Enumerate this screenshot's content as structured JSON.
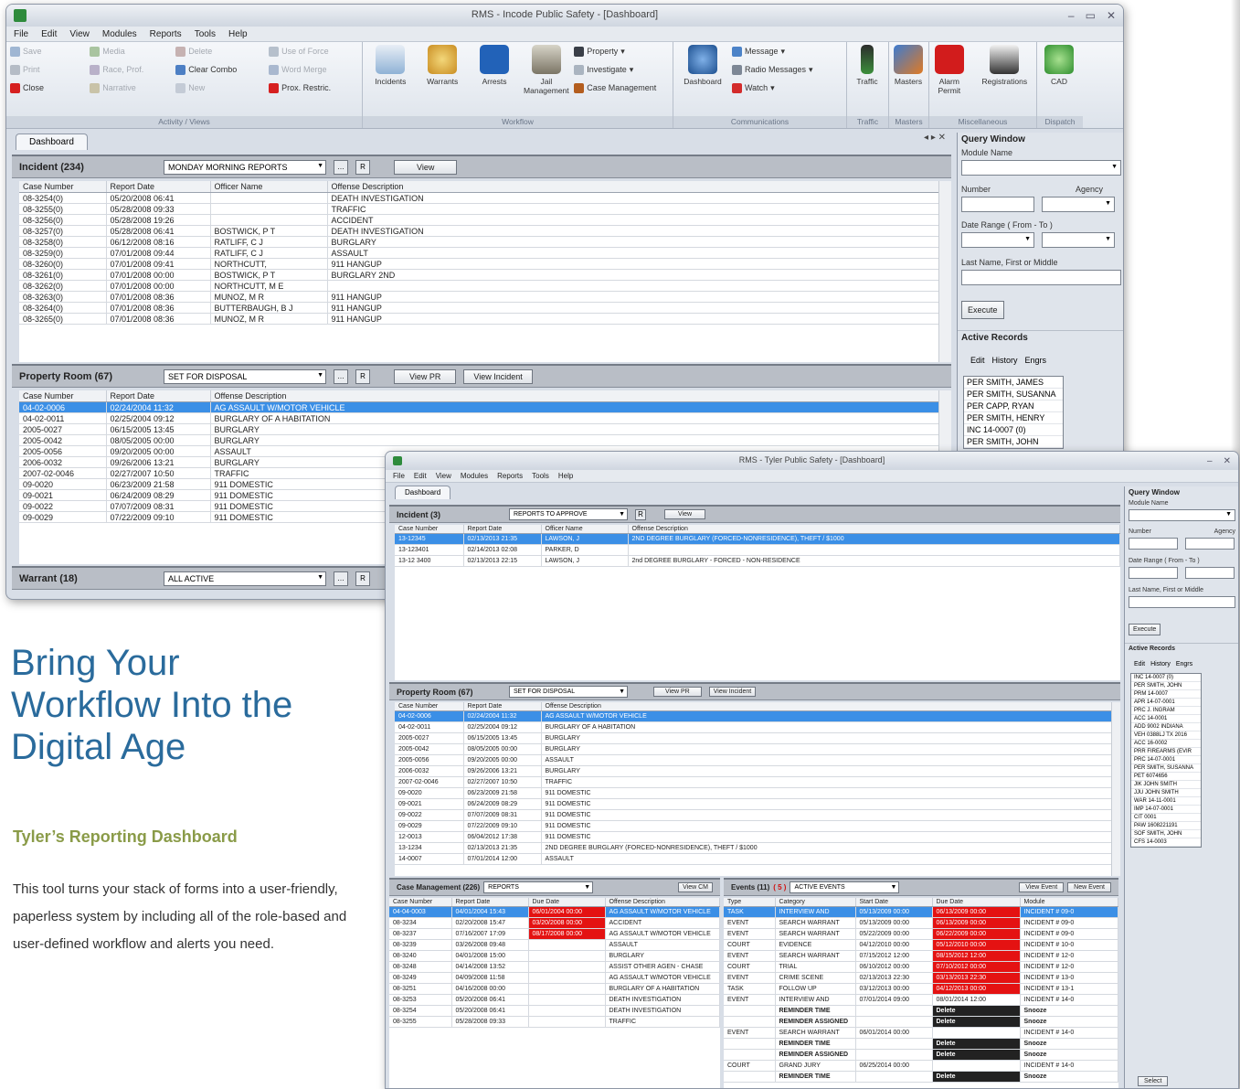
{
  "win1": {
    "title": "RMS - Incode Public Safety - [Dashboard]",
    "menu": [
      "File",
      "Edit",
      "View",
      "Modules",
      "Reports",
      "Tools",
      "Help"
    ],
    "ribbon": {
      "activity": {
        "items": [
          "Save",
          "Media",
          "Delete",
          "Use of Force",
          "Print",
          "Race, Prof.",
          "Clear Combo",
          "Word Merge",
          "Close",
          "Narrative",
          "New",
          "Prox. Restric."
        ],
        "title": "Activity / Views"
      },
      "workflow": {
        "big": [
          "Incidents",
          "Warrants",
          "Arrests",
          "Jail Management"
        ],
        "small": [
          "Property",
          "Investigate",
          "Case Management"
        ],
        "title": "Workflow"
      },
      "comms": {
        "big": "Dashboard",
        "small": [
          "Message",
          "Radio Messages",
          "Watch"
        ],
        "title": "Communications"
      },
      "traffic": {
        "big": "Traffic",
        "title": "Traffic"
      },
      "masters": {
        "big": "Masters",
        "title": "Masters"
      },
      "misc": {
        "big": [
          "Alarm Permit",
          "Registrations"
        ],
        "title": "Miscellaneous"
      },
      "dispatch": {
        "big": "CAD",
        "title": "Dispatch"
      }
    },
    "tab": "Dashboard",
    "tab_ctl": "◂ ▸ ✕",
    "incident": {
      "title": "Incident (234)",
      "filter": "MONDAY MORNING REPORTS",
      "btn_r": "R",
      "view": "View",
      "headers": [
        "Case Number",
        "Report Date",
        "Officer Name",
        "Offense Description"
      ],
      "rows": [
        [
          "08-3254(0)",
          "05/20/2008 06:41",
          "",
          "DEATH INVESTIGATION"
        ],
        [
          "08-3255(0)",
          "05/28/2008 09:33",
          "",
          "TRAFFIC"
        ],
        [
          "08-3256(0)",
          "05/28/2008 19:26",
          "",
          "ACCIDENT"
        ],
        [
          "08-3257(0)",
          "05/28/2008 06:41",
          "BOSTWICK, P T",
          "DEATH INVESTIGATION"
        ],
        [
          "08-3258(0)",
          "06/12/2008 08:16",
          "RATLIFF, C J",
          "BURGLARY"
        ],
        [
          "08-3259(0)",
          "07/01/2008 09:44",
          "RATLIFF, C J",
          "ASSAULT"
        ],
        [
          "08-3260(0)",
          "07/01/2008 09:41",
          "NORTHCUTT,",
          "911 HANGUP"
        ],
        [
          "08-3261(0)",
          "07/01/2008 00:00",
          "BOSTWICK, P T",
          "BURGLARY 2ND"
        ],
        [
          "08-3262(0)",
          "07/01/2008 00:00",
          "NORTHCUTT, M E",
          ""
        ],
        [
          "08-3263(0)",
          "07/01/2008 08:36",
          "MUNOZ, M R",
          "911 HANGUP"
        ],
        [
          "08-3264(0)",
          "07/01/2008 08:36",
          "BUTTERBAUGH, B J",
          "911 HANGUP"
        ],
        [
          "08-3265(0)",
          "07/01/2008 08:36",
          "MUNOZ, M R",
          "911 HANGUP"
        ]
      ]
    },
    "property": {
      "title": "Property Room (67)",
      "filter": "SET FOR DISPOSAL",
      "view_pr": "View PR",
      "view_inc": "View Incident",
      "headers": [
        "Case Number",
        "Report Date",
        "Offense Description"
      ],
      "rows": [
        [
          "04-02-0006",
          "02/24/2004 11:32",
          "AG ASSAULT W/MOTOR VEHICLE"
        ],
        [
          "04-02-0011",
          "02/25/2004 09:12",
          "BURGLARY OF A HABITATION"
        ],
        [
          "2005-0027",
          "06/15/2005 13:45",
          "BURGLARY"
        ],
        [
          "2005-0042",
          "08/05/2005 00:00",
          "BURGLARY"
        ],
        [
          "2005-0056",
          "09/20/2005 00:00",
          "ASSAULT"
        ],
        [
          "2006-0032",
          "09/26/2006 13:21",
          "BURGLARY"
        ],
        [
          "2007-02-0046",
          "02/27/2007 10:50",
          "TRAFFIC"
        ],
        [
          "09-0020",
          "06/23/2009 21:58",
          "911 DOMESTIC"
        ],
        [
          "09-0021",
          "06/24/2009 08:29",
          "911 DOMESTIC"
        ],
        [
          "09-0022",
          "07/07/2009 08:31",
          "911 DOMESTIC"
        ],
        [
          "09-0029",
          "07/22/2009 09:10",
          "911 DOMESTIC"
        ]
      ]
    },
    "warrant": {
      "title": "Warrant (18)",
      "filter": "ALL ACTIVE"
    },
    "query": {
      "title": "Query Window",
      "module": "Module Name",
      "number": "Number",
      "agency": "Agency",
      "date_range": "Date Range ( From - To )",
      "lastname": "Last Name, First or Middle",
      "execute": "Execute",
      "active": "Active Records",
      "tabs": [
        "Edit",
        "History",
        "Engrs"
      ],
      "records": [
        [
          "PER",
          "SMITH, JAMES"
        ],
        [
          "PER",
          "SMITH, SUSANNA"
        ],
        [
          "PER",
          "CAPP, RYAN"
        ],
        [
          "PER",
          "SMITH, HENRY"
        ],
        [
          "INC",
          "14-0007 (0)"
        ],
        [
          "PER",
          "SMITH, JOHN"
        ]
      ]
    }
  },
  "win2": {
    "title": "RMS - Tyler Public Safety - [Dashboard]",
    "menu": [
      "File",
      "Edit",
      "View",
      "Modules",
      "Reports",
      "Tools",
      "Help"
    ],
    "tab": "Dashboard",
    "incident": {
      "title": "Incident (3)",
      "filter": "REPORTS TO APPROVE",
      "view": "View",
      "headers": [
        "Case Number",
        "Report Date",
        "Officer Name",
        "Offense Description"
      ],
      "rows": [
        [
          "13-12345",
          "02/13/2013 21:35",
          "LAWSON, J",
          "2ND DEGREE BURGLARY (FORCED-NONRESIDENCE), THEFT / $1000"
        ],
        [
          "13-123401",
          "02/14/2013 02:08",
          "PARKER, D",
          ""
        ],
        [
          "13-12 3400",
          "02/13/2013 22:15",
          "LAWSON, J",
          "2nd DEGREE BURGLARY - FORCED - NON-RESIDENCE"
        ]
      ]
    },
    "property": {
      "title": "Property Room (67)",
      "filter": "SET FOR DISPOSAL",
      "view_pr": "View PR",
      "view_inc": "View Incident",
      "headers": [
        "Case Number",
        "Report Date",
        "Offense Description"
      ],
      "rows": [
        [
          "04-02-0006",
          "02/24/2004 11:32",
          "AG ASSAULT W/MOTOR VEHICLE"
        ],
        [
          "04-02-0011",
          "02/25/2004 09:12",
          "BURGLARY OF A HABITATION"
        ],
        [
          "2005-0027",
          "06/15/2005 13:45",
          "BURGLARY"
        ],
        [
          "2005-0042",
          "08/05/2005 00:00",
          "BURGLARY"
        ],
        [
          "2005-0056",
          "09/20/2005 00:00",
          "ASSAULT"
        ],
        [
          "2006-0032",
          "09/26/2006 13:21",
          "BURGLARY"
        ],
        [
          "2007-02-0046",
          "02/27/2007 10:50",
          "TRAFFIC"
        ],
        [
          "09-0020",
          "06/23/2009 21:58",
          "911 DOMESTIC"
        ],
        [
          "09-0021",
          "06/24/2009 08:29",
          "911 DOMESTIC"
        ],
        [
          "09-0022",
          "07/07/2009 08:31",
          "911 DOMESTIC"
        ],
        [
          "09-0029",
          "07/22/2009 09:10",
          "911 DOMESTIC"
        ],
        [
          "12-0013",
          "06/04/2012 17:38",
          "911 DOMESTIC"
        ],
        [
          "13-1234",
          "02/13/2013 21:35",
          "2ND DEGREE BURGLARY (FORCED-NONRESIDENCE), THEFT / $1000"
        ],
        [
          "14-0007",
          "07/01/2014 12:00",
          "ASSAULT"
        ]
      ]
    },
    "casemgmt": {
      "title": "Case Management (226)",
      "filter": "REPORTS",
      "view": "View CM",
      "headers": [
        "Case Number",
        "Report Date",
        "Due Date",
        "Offense Description"
      ],
      "rows": [
        [
          "04-04-0003",
          "04/01/2004 15:43",
          "06/01/2004 00:00",
          "AG ASSAULT W/MOTOR VEHICLE"
        ],
        [
          "08-3234",
          "02/20/2008 15:47",
          "03/20/2008 00:00",
          "ACCIDENT"
        ],
        [
          "08-3237",
          "07/16/2007 17:09",
          "08/17/2008 00:00",
          "AG ASSAULT W/MOTOR VEHICLE"
        ],
        [
          "08-3239",
          "03/26/2008 09:48",
          "",
          "ASSAULT"
        ],
        [
          "08-3240",
          "04/01/2008 15:00",
          "",
          "BURGLARY"
        ],
        [
          "08-3248",
          "04/14/2008 13:52",
          "",
          "ASSIST OTHER AGEN - CHASE"
        ],
        [
          "08-3249",
          "04/09/2008 11:58",
          "",
          "AG ASSAULT W/MOTOR VEHICLE"
        ],
        [
          "08-3251",
          "04/16/2008 00:00",
          "",
          "BURGLARY OF A HABITATION"
        ],
        [
          "08-3253",
          "05/20/2008 06:41",
          "",
          "DEATH INVESTIGATION"
        ],
        [
          "08-3254",
          "05/20/2008 06:41",
          "",
          "DEATH INVESTIGATION"
        ],
        [
          "08-3255",
          "05/28/2008 09:33",
          "",
          "TRAFFIC"
        ]
      ]
    },
    "events": {
      "title": "Events (11)",
      "count_badge": "( 5 )",
      "filter": "ACTIVE EVENTS",
      "view": "View Event",
      "new": "New Event",
      "headers": [
        "Type",
        "Category",
        "Start Date",
        "Due Date",
        "Module"
      ],
      "rows": [
        [
          "TASK",
          "INTERVIEW AND",
          "05/13/2009 00:00",
          "06/13/2009 00:00",
          "INCIDENT # 09-0"
        ],
        [
          "EVENT",
          "SEARCH WARRANT",
          "05/13/2009 00:00",
          "06/13/2009 00:00",
          "INCIDENT # 09-0"
        ],
        [
          "EVENT",
          "SEARCH WARRANT",
          "05/22/2009 00:00",
          "06/22/2009 00:00",
          "INCIDENT # 09-0"
        ],
        [
          "COURT",
          "EVIDENCE",
          "04/12/2010 00:00",
          "05/12/2010 00:00",
          "INCIDENT # 10-0"
        ],
        [
          "EVENT",
          "SEARCH WARRANT",
          "07/15/2012 12:00",
          "08/15/2012 12:00",
          "INCIDENT # 12-0"
        ],
        [
          "COURT",
          "TRIAL",
          "06/10/2012 00:00",
          "07/10/2012 00:00",
          "INCIDENT # 12-0"
        ],
        [
          "EVENT",
          "CRIME SCENE",
          "02/13/2013 22:30",
          "03/13/2013 22:30",
          "INCIDENT # 13-0"
        ],
        [
          "TASK",
          "FOLLOW UP",
          "03/12/2013 00:00",
          "04/12/2013 00:00",
          "INCIDENT # 13-1"
        ],
        [
          "EVENT",
          "INTERVIEW AND",
          "07/01/2014 09:00",
          "08/01/2014 12:00",
          "INCIDENT # 14-0"
        ]
      ],
      "reminders": [
        "REMINDER TIME",
        "REMINDER ASSIGNED",
        "REMINDER TIME",
        "REMINDER ASSIGNED",
        "REMINDER TIME"
      ],
      "delete": "Delete",
      "snooze": "Snooze",
      "tail": [
        [
          "EVENT",
          "SEARCH WARRANT",
          "06/01/2014 00:00",
          "",
          "INCIDENT # 14-0"
        ],
        [
          "COURT",
          "GRAND JURY",
          "06/25/2014 00:00",
          "",
          "INCIDENT # 14-0"
        ]
      ]
    },
    "query": {
      "title": "Query Window",
      "module": "Module Name",
      "number": "Number",
      "agency": "Agency",
      "date_range": "Date Range ( From - To )",
      "lastname": "Last Name, First or Middle",
      "execute": "Execute",
      "active": "Active Records",
      "tabs": [
        "Edit",
        "History",
        "Engrs"
      ],
      "select": "Select",
      "records": [
        [
          "INC",
          "14-0007 (0)"
        ],
        [
          "PER",
          "SMITH, JOHN"
        ],
        [
          "PRM",
          "14-0007"
        ],
        [
          "APR",
          "14-07-0001"
        ],
        [
          "PRC",
          "J. INGRAM"
        ],
        [
          "ACC",
          "14-0001"
        ],
        [
          "ADD",
          "9002 INDIANA"
        ],
        [
          "VEH",
          "0388LJ TX 2016"
        ],
        [
          "ACC",
          "16-0002"
        ],
        [
          "PRR",
          "FIREARMS (EVIR"
        ],
        [
          "PRC",
          "14-07-0001"
        ],
        [
          "PER",
          "SMITH, SUSANNA"
        ],
        [
          "PET",
          "6074656"
        ],
        [
          "JIK",
          "JOHN SMITH"
        ],
        [
          "JJU",
          "JOHN SMITH"
        ],
        [
          "WAR",
          "14-11-0001"
        ],
        [
          "IMP",
          "14-07-0001"
        ],
        [
          "CIT",
          "0001"
        ],
        [
          "PAW",
          "1608221191"
        ],
        [
          "SOF",
          "SMITH, JOHN"
        ],
        [
          "CFS",
          "14-0003"
        ]
      ]
    }
  },
  "marketing": {
    "headline_lines": [
      "Bring Your",
      "Workflow Into the",
      "Digital Age"
    ],
    "subheading": "Tyler’s Reporting Dashboard",
    "body": "This tool turns your stack of forms into a user-friendly, paperless system by including all of the role-based and user-defined workflow and alerts you need."
  },
  "colors": {
    "selection": "#3b8fe6",
    "alert_red": "#e41212",
    "headline": "#2a6b9c",
    "subheading": "#8a9b48"
  }
}
